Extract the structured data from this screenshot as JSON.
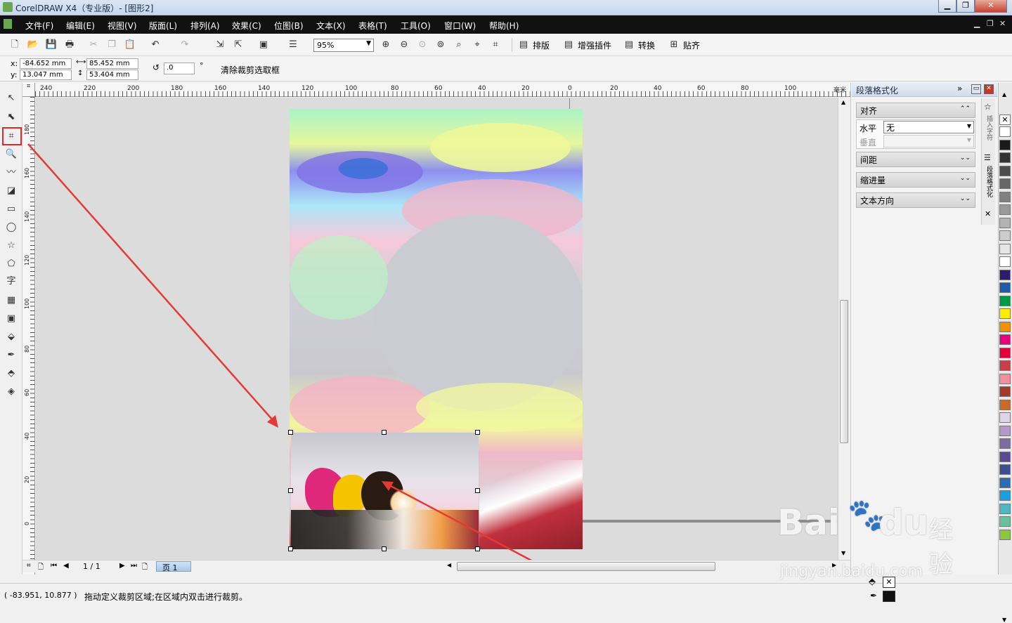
{
  "window": {
    "title": "CorelDRAW X4（专业版）- [图形2]",
    "min": "▁",
    "max": "❐",
    "close": "✕"
  },
  "menu": [
    "文件(F)",
    "编辑(E)",
    "视图(V)",
    "版面(L)",
    "排列(A)",
    "效果(C)",
    "位图(B)",
    "文本(X)",
    "表格(T)",
    "工具(O)",
    "窗口(W)",
    "帮助(H)"
  ],
  "toolbar": {
    "zoom": "95%",
    "buttons": [
      "排版",
      "增强插件",
      "转换",
      "贴齐"
    ]
  },
  "propbar": {
    "x_label": "x:",
    "x": "-84.652 mm",
    "y_label": "y:",
    "y": "13.047 mm",
    "w": "85.452 mm",
    "h": "53.404 mm",
    "angle": ".0",
    "deg": "°",
    "clear_crop": "清除裁剪选取框"
  },
  "ruler_h": [
    "240",
    "220",
    "200",
    "180",
    "160",
    "140",
    "120",
    "100",
    "80",
    "60",
    "40",
    "20",
    "0",
    "20",
    "40",
    "60",
    "80",
    "100"
  ],
  "ruler_h_unit": "毫米",
  "ruler_v": [
    "180",
    "160",
    "140",
    "120",
    "100",
    "80",
    "60",
    "40",
    "20",
    "0"
  ],
  "docker": {
    "title": "段落格式化",
    "sections": [
      "对齐",
      "间距",
      "缩进量",
      "文本方向"
    ],
    "h_label": "水平",
    "h_value": "无",
    "v_label": "垂直",
    "tabs": [
      "插入字符",
      "段落格式化"
    ]
  },
  "pager": {
    "current": "1 / 1",
    "tab": "页 1"
  },
  "status": {
    "coords": "( -83.951, 10.877 )",
    "hint": "拖动定义裁剪区域;在区域内双击进行裁剪。"
  },
  "palette": [
    "#ffffff",
    "#1a1a1a",
    "#333333",
    "#4d4d4d",
    "#666666",
    "#808080",
    "#999999",
    "#b3b3b3",
    "#cccccc",
    "#e6e6e6",
    "#ffffff",
    "#2e1a6e",
    "#1e5aa8",
    "#009a44",
    "#ffed00",
    "#f39200",
    "#e6007e",
    "#e4003a",
    "#c63f4b",
    "#f28e9e",
    "#a33b2a",
    "#c66b2d",
    "#e0d5e6",
    "#b399c9",
    "#7f6aa8",
    "#5b4a8c",
    "#3e4d8c",
    "#2a6bb3",
    "#1aa0dc",
    "#4fb6c4",
    "#6bbf9f",
    "#8cc63f"
  ],
  "watermark": {
    "brand": "Bai",
    "brand2": "du",
    "jy": "经验",
    "url": "jingyan.baidu.com"
  }
}
